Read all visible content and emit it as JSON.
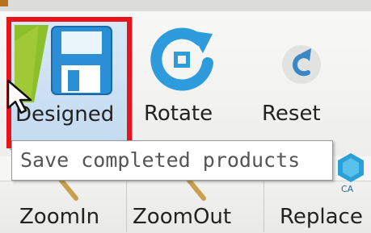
{
  "toolbar": {
    "designed": {
      "label": "Designed",
      "icon": "save-disk-icon"
    },
    "rotate": {
      "label": "Rotate",
      "icon": "rotate-icon"
    },
    "reset": {
      "label": "Reset",
      "icon": "reset-arrow-icon"
    }
  },
  "tooltip": {
    "text": "Save completed products"
  },
  "toolbar2": {
    "zoomin": {
      "label": "ZoomIn",
      "icon": "magnifier-icon"
    },
    "zoomout": {
      "label": "ZoomOut",
      "icon": "magnifier-icon"
    },
    "replace": {
      "label": "Replace",
      "icon": "replace-icon",
      "badge": "CA"
    }
  },
  "colors": {
    "highlight": "#e8141c",
    "save_icon": "#2a8fd6",
    "rotate_icon": "#2e9bdc",
    "tooltip_bg": "#ffffff"
  }
}
